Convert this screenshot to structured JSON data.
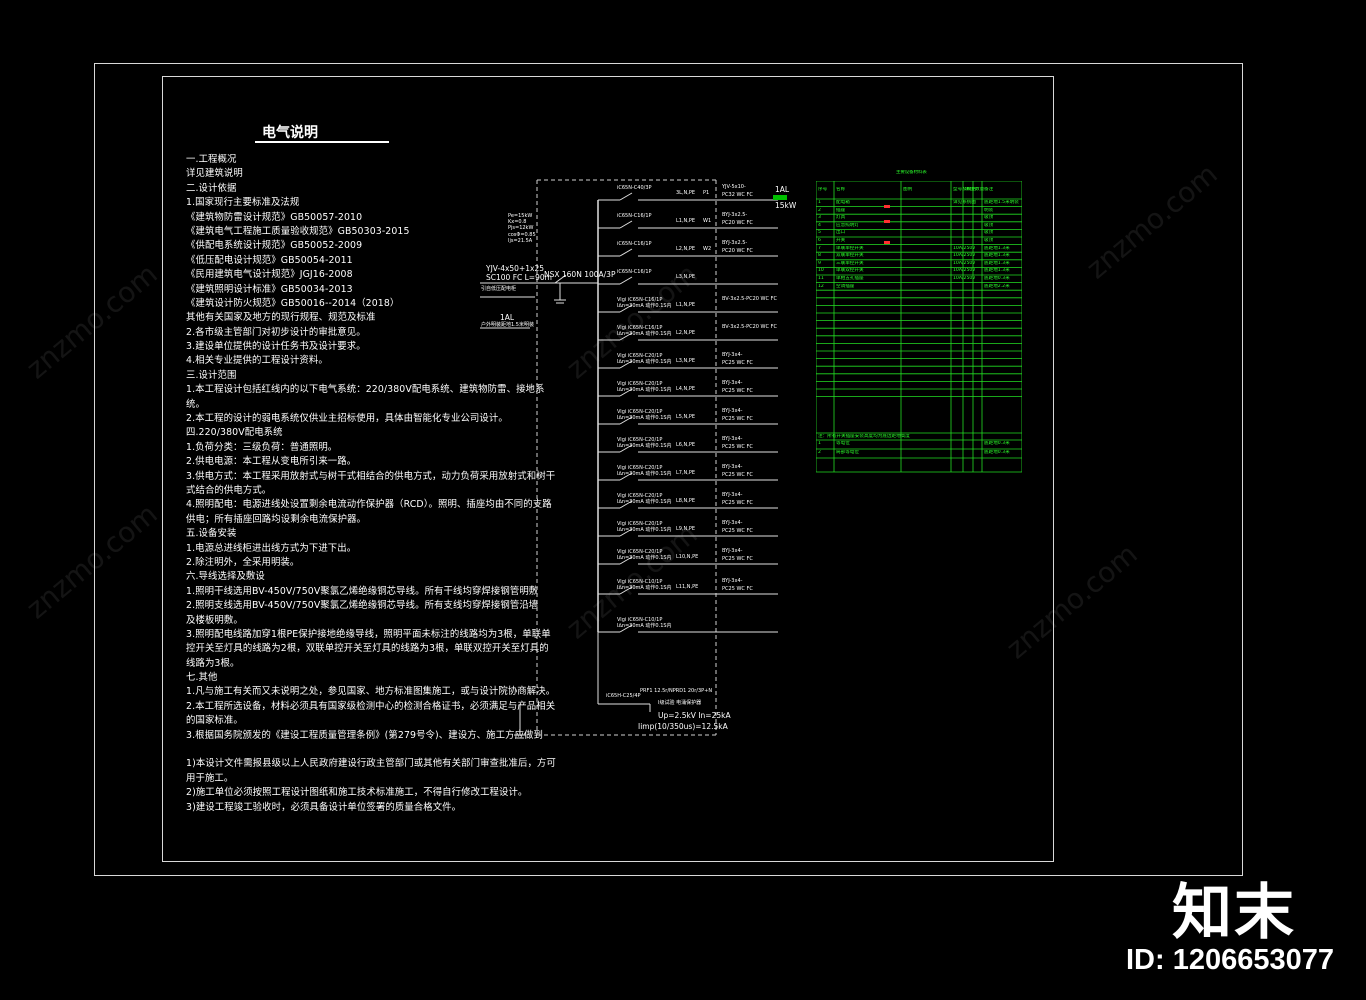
{
  "drawing": {
    "title": "电气说明",
    "notes": [
      "一.工程概况",
      "详见建筑说明",
      "二.设计依据",
      "1.国家现行主要标准及法规",
      "《建筑物防雷设计规范》GB50057-2010",
      "《建筑电气工程施工质量验收规范》GB50303-2015",
      "《供配电系统设计规范》GB50052-2009",
      "《低压配电设计规范》GB50054-2011",
      "《民用建筑电气设计规范》JGJ16-2008",
      "《建筑照明设计标准》GB50034-2013",
      "《建筑设计防火规范》GB50016--2014（2018）",
      "其他有关国家及地方的现行规程、规范及标准",
      "2.各市级主管部门对初步设计的审批意见。",
      "3.建设单位提供的设计任务书及设计要求。",
      "4.相关专业提供的工程设计资料。",
      "三.设计范围",
      "1.本工程设计包括红线内的以下电气系统：220/380V配电系统、建筑物防雷、接地系",
      "统。",
      "2.本工程的设计的弱电系统仅供业主招标使用，具体由智能化专业公司设计。",
      "四.220/380V配电系统",
      "1.负荷分类：三级负荷：普通照明。",
      "2.供电电源：本工程从变电所引来一路。",
      "3.供电方式：本工程采用放射式与树干式相结合的供电方式，动力负荷采用放射式和树干",
      "式结合的供电方式。",
      "4.照明配电：电源进线处设置剩余电流动作保护器（RCD）。照明、插座均由不同的支路",
      "供电；所有插座回路均设剩余电流保护器。",
      "五.设备安装",
      "1.电源总进线柜进出线方式为下进下出。",
      "2.除注明外，全采用明装。",
      "六.导线选择及敷设",
      "1.照明干线选用BV-450V/750V聚氯乙烯绝缘铜芯导线。所有干线均穿焊接钢管明敷",
      "2.照明支线选用BV-450V/750V聚氯乙烯绝缘铜芯导线。所有支线均穿焊接钢管沿墙",
      "及楼板明敷。",
      "3.照明配电线路加穿1根PE保护接地绝缘导线，照明平面未标注的线路均为3根，单联单",
      "控开关至灯具的线路为2根，双联单控开关至灯具的线路为3根，单联双控开关至灯具的",
      "线路为3根。",
      "七.其他",
      "1.凡与施工有关而又未说明之处，参见国家、地方标准图集施工，或与设计院协商解决。",
      "2.本工程所选设备，材料必须具有国家级检测中心的检测合格证书，必须满足与产品相关",
      "的国家标准。",
      "3.根据国务院颁发的《建设工程质量管理条例》(第279号令)、建设方、施工方应做到",
      "",
      "1)本设计文件需报县级以上人民政府建设行政主管部门或其他有关部门审查批准后，方可",
      "用于施工。",
      "2)施工单位必须按照工程设计图纸和施工技术标准施工，不得自行修改工程设计。",
      "3)建设工程竣工验收时，必须具备设计单位签署的质量合格文件。"
    ]
  },
  "diagram": {
    "params": [
      "Pe=15kW",
      "Kx=0.8",
      "Pjs=12kW",
      "cosΦ=0.85",
      "Ijs=21.5A"
    ],
    "incoming_cable": "YJV-4x50+1x25",
    "incoming_conduit": "SC100 FC  L=90m",
    "incoming_source": "引自低压配电柜",
    "panel_name": "1AL",
    "panel_note": "户外明装距地1.5米明装",
    "main_breaker": "NSX 160N 100A/3P",
    "branches": [
      {
        "breaker": "iC65N-C40/3P",
        "leak": "",
        "phase": "3L,N,PE",
        "circuit": "P1",
        "cable": "YJV-5x10-",
        "conduit": "PC32  WC FC"
      },
      {
        "breaker": "iC65N-C16/1P",
        "leak": "",
        "phase": "L1,N,PE",
        "circuit": "W1",
        "cable": "BYJ-3x2.5-",
        "conduit": "PC20  WC FC"
      },
      {
        "breaker": "iC65N-C16/1P",
        "leak": "",
        "phase": "L2,N,PE",
        "circuit": "W2",
        "cable": "BYJ-3x2.5-",
        "conduit": "PC20  WC FC"
      },
      {
        "breaker": "iC65N-C16/1P",
        "leak": "",
        "phase": "L3,N,PE",
        "circuit": "",
        "cable": "",
        "conduit": ""
      },
      {
        "breaker": "Vigi iC65N-C16/1P",
        "leak": "I∆n=30mA 动作0.1S内",
        "phase": "L1,N,PE",
        "circuit": "",
        "cable": "BV-3x2.5-PC20 WC FC",
        "conduit": ""
      },
      {
        "breaker": "Vigi iC65N-C16/1P",
        "leak": "I∆n=30mA 动作0.1S内",
        "phase": "L2,N,PE",
        "circuit": "",
        "cable": "BV-3x2.5-PC20 WC FC",
        "conduit": ""
      },
      {
        "breaker": "Vigi iC65N-C20/1P",
        "leak": "I∆n=30mA 动作0.1S内",
        "phase": "L3,N,PE",
        "circuit": "",
        "cable": "BYJ-3x4-",
        "conduit": "PC25  WC FC"
      },
      {
        "breaker": "Vigi iC65N-C20/1P",
        "leak": "I∆n=30mA 动作0.1S内",
        "phase": "L4,N,PE",
        "circuit": "",
        "cable": "BYJ-3x4-",
        "conduit": "PC25  WC FC"
      },
      {
        "breaker": "Vigi iC65N-C20/1P",
        "leak": "I∆n=30mA 动作0.1S内",
        "phase": "L5,N,PE",
        "circuit": "",
        "cable": "BYJ-3x4-",
        "conduit": "PC25  WC FC"
      },
      {
        "breaker": "Vigi iC65N-C20/1P",
        "leak": "I∆n=30mA 动作0.1S内",
        "phase": "L6,N,PE",
        "circuit": "",
        "cable": "BYJ-3x4-",
        "conduit": "PC25  WC FC"
      },
      {
        "breaker": "Vigi iC65N-C20/1P",
        "leak": "I∆n=30mA 动作0.1S内",
        "phase": "L7,N,PE",
        "circuit": "",
        "cable": "BYJ-3x4-",
        "conduit": "PC25  WC FC"
      },
      {
        "breaker": "Vigi iC65N-C20/1P",
        "leak": "I∆n=30mA 动作0.1S内",
        "phase": "L8,N,PE",
        "circuit": "",
        "cable": "BYJ-3x4-",
        "conduit": "PC25  WC FC"
      },
      {
        "breaker": "Vigi iC65N-C20/1P",
        "leak": "I∆n=30mA 动作0.1S内",
        "phase": "L9,N,PE",
        "circuit": "",
        "cable": "BYJ-3x4-",
        "conduit": "PC25  WC FC"
      },
      {
        "breaker": "Vigi iC65N-C20/1P",
        "leak": "I∆n=30mA 动作0.1S内",
        "phase": "L10,N,PE",
        "circuit": "",
        "cable": "BYJ-3x4-",
        "conduit": "PC25  WC FC"
      },
      {
        "breaker": "Vigi iC65N-C10/1P",
        "leak": "I∆n=30mA 动作0.1S内",
        "phase": "L11,N,PE",
        "circuit": "",
        "cable": "BYJ-3x4-",
        "conduit": "PC25  WC FC"
      },
      {
        "breaker": "Vigi iC65N-C10/1P",
        "leak": "I∆n=30mA 动作0.1S内",
        "phase": "",
        "circuit": "",
        "cable": "",
        "conduit": ""
      }
    ],
    "out_top_name": "1AL",
    "out_top_power": "15kW",
    "spd_breaker": "iC65H-C25/4P",
    "spd_model": "PRF1 12.5r/NPRD1 20r/3P+N",
    "spd_note": "I级试验 电涌保护器",
    "spd_up": "Up=2.5kV In=25kA",
    "spd_imp": "Iimp(10/350us)=12.5kA"
  },
  "legend_table": {
    "title": "主要设备材料表",
    "headers": [
      "序号",
      "名称",
      "图例",
      "型号及规格",
      "单位",
      "数量",
      "备注"
    ],
    "rows": [
      [
        "1",
        "配电箱",
        "",
        "详见系统图",
        "",
        "",
        "底距地1.5米明装"
      ],
      [
        "2",
        "插座",
        "",
        "",
        "",
        "",
        "明装"
      ],
      [
        "3",
        "灯具",
        "",
        "",
        "",
        "",
        "吸顶"
      ],
      [
        "4",
        "应急照明灯",
        "",
        "",
        "",
        "",
        "吸顶"
      ],
      [
        "5",
        "出口",
        "",
        "",
        "",
        "",
        "吸顶"
      ],
      [
        "6",
        "开关",
        "",
        "",
        "",
        "",
        "吸顶"
      ],
      [
        "7",
        "单联单控开关",
        "",
        "10A/250V",
        "",
        "",
        "底距地1.3米"
      ],
      [
        "8",
        "双联单控开关",
        "",
        "10A/250V",
        "",
        "",
        "底距地1.3米"
      ],
      [
        "9",
        "三联单控开关",
        "",
        "10A/250V",
        "",
        "",
        "底距地1.3米"
      ],
      [
        "10",
        "单联双控开关",
        "",
        "10A/250V",
        "",
        "",
        "底距地1.3米"
      ],
      [
        "11",
        "单相五孔插座",
        "",
        "10A/250V",
        "",
        "",
        "底距地0.3米"
      ],
      [
        "12",
        "空调插座",
        "",
        "",
        "",
        "",
        "底距地2.2米"
      ]
    ],
    "footer_note": "注：所有开关插座安装高度均为底边距地高度",
    "footer_rows": [
      [
        "1",
        "等电位",
        "",
        "",
        "",
        "",
        "底距地0.3米"
      ],
      [
        "2",
        "局部等电位",
        "",
        "",
        "",
        "",
        "底距地0.3米"
      ]
    ]
  },
  "watermark": {
    "brand": "znzmo.com",
    "logo": "知末",
    "id": "ID: 1206653077"
  }
}
